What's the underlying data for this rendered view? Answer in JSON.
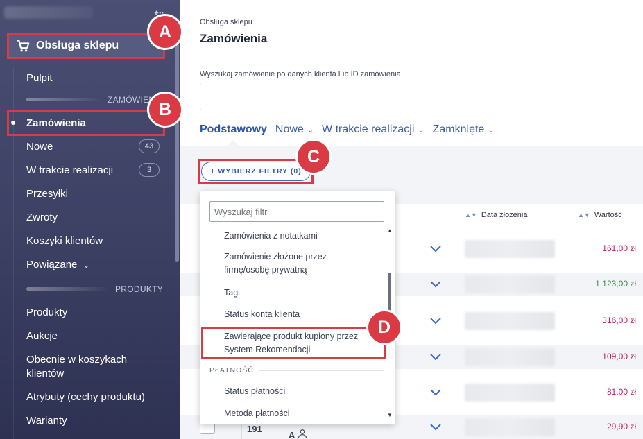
{
  "sidebar": {
    "section_title": "Obsługa sklepu",
    "items": [
      {
        "label": "Pulpit"
      },
      {
        "label": "Zamówienia"
      },
      {
        "label": "Nowe",
        "badge": "43"
      },
      {
        "label": "W trakcie realizacji",
        "badge": "3"
      },
      {
        "label": "Przesyłki"
      },
      {
        "label": "Zwroty"
      },
      {
        "label": "Koszyki klientów"
      },
      {
        "label": "Powiązane"
      },
      {
        "label": "Produkty"
      },
      {
        "label": "Aukcje"
      },
      {
        "label": "Obecnie w koszykach klientów"
      },
      {
        "label": "Atrybuty (cechy produktu)"
      },
      {
        "label": "Warianty"
      }
    ],
    "groups": {
      "orders": "ZAMÓWIENIA",
      "products": "PRODUKTY"
    },
    "icons": {
      "collapse": "collapse-sidebar-icon",
      "cart": "cart-icon",
      "chevron": "chevron-down-icon"
    }
  },
  "header": {
    "breadcrumb": "Obsługa sklepu",
    "title": "Zamówienia"
  },
  "search": {
    "label": "Wyszukaj zamówienie po danych klienta lub ID zamówienia",
    "value": ""
  },
  "tabs": [
    {
      "label": "Podstawowy"
    },
    {
      "label": "Nowe"
    },
    {
      "label": "W trakcie realizacji"
    },
    {
      "label": "Zamknięte"
    }
  ],
  "filters": {
    "button_label": "+ WYBIERZ FILTRY (0)",
    "search_placeholder": "Wyszukaj filtr",
    "items": [
      "Zamówienia z notatkami",
      "Zamówienie złożone przez firmę/osobę prywatną",
      "Tagi",
      "Status konta klienta",
      "Zawierające produkt kupiony przez System Rekomendacji"
    ],
    "section_payment": "PŁATNOŚĆ",
    "payment_items": [
      "Status płatności",
      "Metoda płatności"
    ]
  },
  "table": {
    "columns": {
      "date": "Data złożenia",
      "value": "Wartość"
    },
    "rows": [
      {
        "value": "161,00 zł",
        "status": "red"
      },
      {
        "value": "1 123,00 zł",
        "status": "green"
      },
      {
        "value": "316,00 zł",
        "status": "red"
      },
      {
        "value": "109,00 zł",
        "status": "red"
      },
      {
        "value": "81,00 zł",
        "status": "red"
      },
      {
        "value": "29,90 zł",
        "status": "red"
      }
    ],
    "last_row_id": "191",
    "last_row_icon_text": "A"
  },
  "annotations": {
    "a": "A",
    "b": "B",
    "c": "C",
    "d": "D"
  },
  "colors": {
    "sidebar": "#3c4063",
    "accent": "#2d55a5",
    "highlight": "#d93a44",
    "value_red": "#c2185b",
    "value_green": "#3c8a4c"
  }
}
